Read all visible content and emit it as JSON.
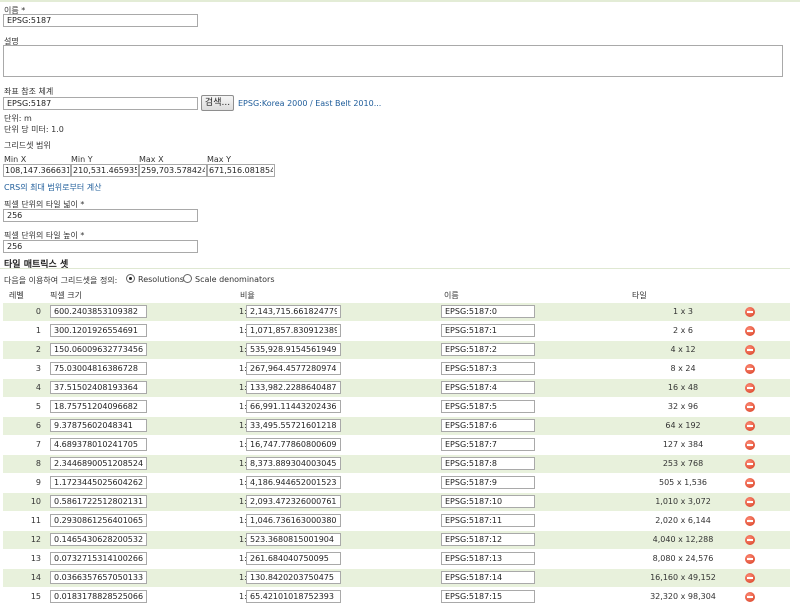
{
  "form": {
    "name_label": "이름 *",
    "name_value": "EPSG:5187",
    "description_label": "설명",
    "crs_label": "좌표 참조 체계",
    "crs_value": "EPSG:5187",
    "search_button": "검색...",
    "crs_link": "EPSG:Korea 2000 / East Belt 2010...",
    "unit_text": "단위: m",
    "meters_per_unit_text": "단위 당 미터: 1.0",
    "gridset_bounds_label": "그리드셋 범위",
    "min_x_label": "Min X",
    "min_y_label": "Min Y",
    "max_x_label": "Max X",
    "max_y_label": "Max Y",
    "min_x": "108,147.36663105",
    "min_y": "210,531.46593547",
    "max_x": "259,703.57842406",
    "max_y": "671,516.08185427",
    "compute_link": "CRS의 최대 범위로부터 계산",
    "tile_width_label": "픽셀 단위의 타일 넓이 *",
    "tile_width": "256",
    "tile_height_label": "픽셀 단위의 타일 높이 *",
    "tile_height": "256"
  },
  "matrix": {
    "title": "타일 매트릭스 셋",
    "define_label": "다음을 이용하여 그리드셋을 정의:",
    "option_resolutions": "Resolutions",
    "option_scale": "Scale denominators",
    "selected": "Resolutions",
    "columns": {
      "level": "레벨",
      "pixel_size": "픽셀 크기",
      "scale": "비율",
      "name": "이름",
      "tiles": "타일"
    },
    "scale_prefix": "1:",
    "row_colors": {
      "alt": "#e8f1dc",
      "plain": "#ffffff"
    },
    "rows": [
      {
        "level": "0",
        "pixel": "600.2403853109382",
        "scale": "2,143,715.6618247796",
        "name": "EPSG:5187:0",
        "tiles": "1 x 3"
      },
      {
        "level": "1",
        "pixel": "300.1201926554691",
        "scale": "1,071,857.8309123898",
        "name": "EPSG:5187:1",
        "tiles": "2 x 6"
      },
      {
        "level": "2",
        "pixel": "150.06009632773456",
        "scale": "535,928.9154561949",
        "name": "EPSG:5187:2",
        "tiles": "4 x 12"
      },
      {
        "level": "3",
        "pixel": "75.03004816386728",
        "scale": "267,964.45772809745",
        "name": "EPSG:5187:3",
        "tiles": "8 x 24"
      },
      {
        "level": "4",
        "pixel": "37.51502408193364",
        "scale": "133,982.22886404872",
        "name": "EPSG:5187:4",
        "tiles": "16 x 48"
      },
      {
        "level": "5",
        "pixel": "18.75751204096682",
        "scale": "66,991.11443202436",
        "name": "EPSG:5187:5",
        "tiles": "32 x 96"
      },
      {
        "level": "6",
        "pixel": "9.37875602048341",
        "scale": "33,495.55721601218",
        "name": "EPSG:5187:6",
        "tiles": "64 x 192"
      },
      {
        "level": "7",
        "pixel": "4.689378010241705",
        "scale": "16,747.77860800609",
        "name": "EPSG:5187:7",
        "tiles": "127 x 384"
      },
      {
        "level": "8",
        "pixel": "2.3446890051208524",
        "scale": "8,373.889304003045",
        "name": "EPSG:5187:8",
        "tiles": "253 x 768"
      },
      {
        "level": "9",
        "pixel": "1.1723445025604262",
        "scale": "4,186.944652001523",
        "name": "EPSG:5187:9",
        "tiles": "505 x 1,536"
      },
      {
        "level": "10",
        "pixel": "0.5861722512802131",
        "scale": "2,093.4723260007613",
        "name": "EPSG:5187:10",
        "tiles": "1,010 x 3,072"
      },
      {
        "level": "11",
        "pixel": "0.29308612564010655",
        "scale": "1,046.7361630003809",
        "name": "EPSG:5187:11",
        "tiles": "2,020 x 6,144"
      },
      {
        "level": "12",
        "pixel": "0.14654306282005328",
        "scale": "523.3680815001904",
        "name": "EPSG:5187:12",
        "tiles": "4,040 x 12,288"
      },
      {
        "level": "13",
        "pixel": "0.07327153141002664",
        "scale": "261.684040750095",
        "name": "EPSG:5187:13",
        "tiles": "8,080 x 24,576"
      },
      {
        "level": "14",
        "pixel": "0.03663576570501332",
        "scale": "130.8420203750475",
        "name": "EPSG:5187:14",
        "tiles": "16,160 x 49,152"
      },
      {
        "level": "15",
        "pixel": "0.01831788285250666",
        "scale": "65.42101018752393",
        "name": "EPSG:5187:15",
        "tiles": "32,320 x 98,304"
      }
    ]
  }
}
